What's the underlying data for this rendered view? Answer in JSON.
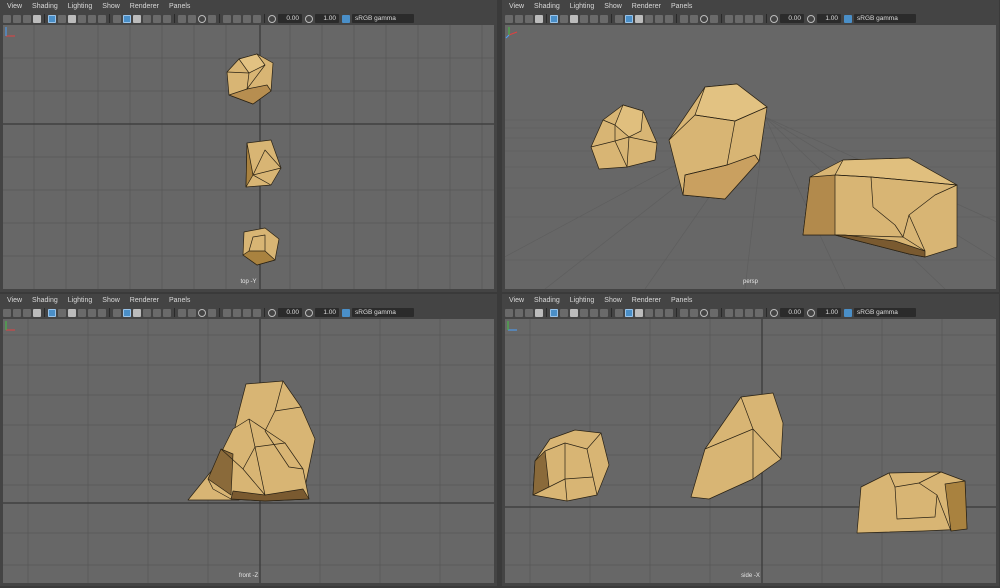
{
  "menu": [
    "View",
    "Shading",
    "Lighting",
    "Show",
    "Renderer",
    "Panels"
  ],
  "toolbar": {
    "field_a": "0.00",
    "field_b": "1.00",
    "color_space": "sRGB gamma"
  },
  "panels": [
    {
      "camera": "top -Y"
    },
    {
      "camera": "persp"
    },
    {
      "camera": "front -Z"
    },
    {
      "camera": "side -X"
    }
  ],
  "colors": {
    "rock_light": "#d8b574",
    "rock_mid": "#c9a060",
    "rock_dark": "#8a6a3a",
    "grid": "#585858",
    "viewport_bg": "#676767",
    "accent": "#4a8fc8"
  }
}
